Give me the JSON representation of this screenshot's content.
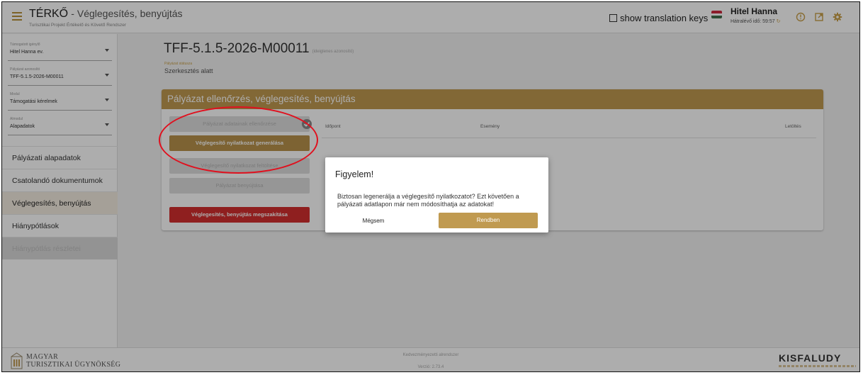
{
  "header": {
    "app_name": "TÉRKŐ",
    "page_title": "Véglegesítés, benyújtás",
    "subtitle": "Turisztikai Projekt Értékelő és Követő Rendszer",
    "translation_keys_label": "show translation keys",
    "user_name": "Hitel Hanna",
    "timer_label": "Hátralévő idő: 59:57",
    "icons": [
      "menu-icon",
      "checkbox-icon",
      "hungarian-flag-icon",
      "refresh-icon",
      "info-icon",
      "external-link-icon",
      "settings-icon"
    ]
  },
  "sidebar": {
    "selects": [
      {
        "label": "Támogatott igénylő",
        "value": "Hitel Hanna ev."
      },
      {
        "label": "Pályázat azonosító",
        "value": "TFF-5.1.5-2026-M00011"
      },
      {
        "label": "Modul",
        "value": "Támogatási kérelmek"
      },
      {
        "label": "Almodul",
        "value": "Alapadatok"
      }
    ],
    "nav": [
      {
        "label": "Pályázati alapadatok"
      },
      {
        "label": "Csatolandó dokumentumok"
      },
      {
        "label": "Véglegesítés, benyújtás"
      },
      {
        "label": "Hiánypótlások"
      },
      {
        "label": "Hiánypótlás részletei"
      }
    ]
  },
  "main": {
    "project_id": "TFF-5.1.5-2026-M00011",
    "project_note": "(ideiglenes azonosító)",
    "status_label": "Pályázat státusza",
    "status_value": "Szerkesztés alatt",
    "card_title": "Pályázat ellenőrzés, véglegesítés, benyújtás",
    "buttons": {
      "check": "Pályázat adatainak ellenőrzése",
      "generate": "Véglegesítő nyilatkozat generálása",
      "upload": "Véglegesítő nyilatkozat feltöltése",
      "submit": "Pályázat benyújtása",
      "cancel": "Véglegesítés, benyújtás megszakítása"
    },
    "table_headers": [
      "Időpont",
      "Esemény",
      "Letöltés"
    ]
  },
  "modal": {
    "title": "Figyelem!",
    "text": "Biztosan legenerálja a véglegesítő nyilatkozatot? Ezt követően a pályázati adatlapon már nem módosíthatja az adatokat!",
    "cancel_label": "Mégsem",
    "ok_label": "Rendben"
  },
  "footer": {
    "org_line1": "MAGYAR",
    "org_line2": "TURISZTIKAI ÜGYNÖKSÉG",
    "center_text": "Kedvezményezetti alrendszer",
    "version": "Verzió: 2.73.4",
    "brand": "KISFALUDY"
  },
  "colors": {
    "accent": "#c09a50",
    "danger": "#d32f2f",
    "annotation": "#e0101e"
  }
}
